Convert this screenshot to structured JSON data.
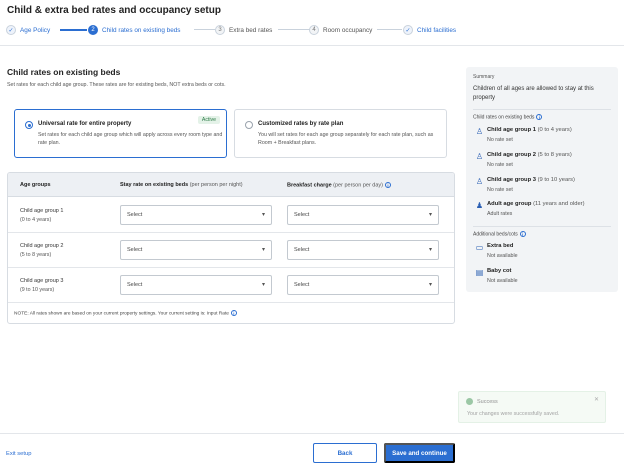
{
  "page": {
    "title": "Child & extra bed rates and occupancy setup"
  },
  "stepper": {
    "steps": [
      {
        "num": "✓",
        "label": "Age Policy",
        "state": "done"
      },
      {
        "num": "2",
        "label": "Child rates on existing beds",
        "state": "current"
      },
      {
        "num": "3",
        "label": "Extra bed rates",
        "state": "todo"
      },
      {
        "num": "4",
        "label": "Room occupancy",
        "state": "todo"
      },
      {
        "num": "✓",
        "label": "Child facilities",
        "state": "done"
      }
    ]
  },
  "section": {
    "title": "Child rates on existing beds",
    "subtitle": "Set rates for each child age group. These rates are for existing beds, NOT extra beds or cots."
  },
  "options": {
    "universal": {
      "title": "Universal rate for entire property",
      "desc": "Set rates for each child age group which will apply across every room type and rate plan.",
      "badge": "Active"
    },
    "custom": {
      "title": "Customized rates by rate plan",
      "desc": "You will set rates for each age group separately for each rate plan, such as Room + Breakfast plans."
    }
  },
  "table": {
    "headers": {
      "age": "Age groups",
      "stay": "Stay rate on existing beds",
      "stay_sub": "(per person per night)",
      "breakfast": "Breakfast charge",
      "breakfast_sub": "(per person per day)"
    },
    "rows": [
      {
        "name": "Child age group 1",
        "range": "(0 to 4 years)",
        "stay": "Select",
        "breakfast": "Select"
      },
      {
        "name": "Child age group 2",
        "range": "(5 to 8 years)",
        "stay": "Select",
        "breakfast": "Select"
      },
      {
        "name": "Child age group 3",
        "range": "(9 to 10 years)",
        "stay": "Select",
        "breakfast": "Select"
      }
    ],
    "note": "NOTE: All rates shown are based on your current property settings. Your current setting is: Input Rate"
  },
  "summary": {
    "title": "Summary",
    "lead": "Children of all ages are allowed to stay at this property",
    "rates_heading": "Child rates on existing beds",
    "items": [
      {
        "name": "Child age group 1",
        "range": "(0 to 4 years)",
        "status": "No rate set"
      },
      {
        "name": "Child age group 2",
        "range": "(5 to 8 years)",
        "status": "No rate set"
      },
      {
        "name": "Child age group 3",
        "range": "(9 to 10 years)",
        "status": "No rate set"
      },
      {
        "name": "Adult age group",
        "range": "(11 years and older)",
        "status": "Adult rates"
      }
    ],
    "beds_heading": "Additional beds/cots",
    "beds": [
      {
        "name": "Extra bed",
        "status": "Not available"
      },
      {
        "name": "Baby cot",
        "status": "Not available"
      }
    ]
  },
  "toast": {
    "title": "Success",
    "message": "Your changes were successfully saved."
  },
  "footer": {
    "exit": "Exit setup",
    "back": "Back",
    "save": "Save and continue"
  },
  "colors": {
    "accent": "#2b6ed1",
    "active_badge": "#e4f2e8"
  }
}
